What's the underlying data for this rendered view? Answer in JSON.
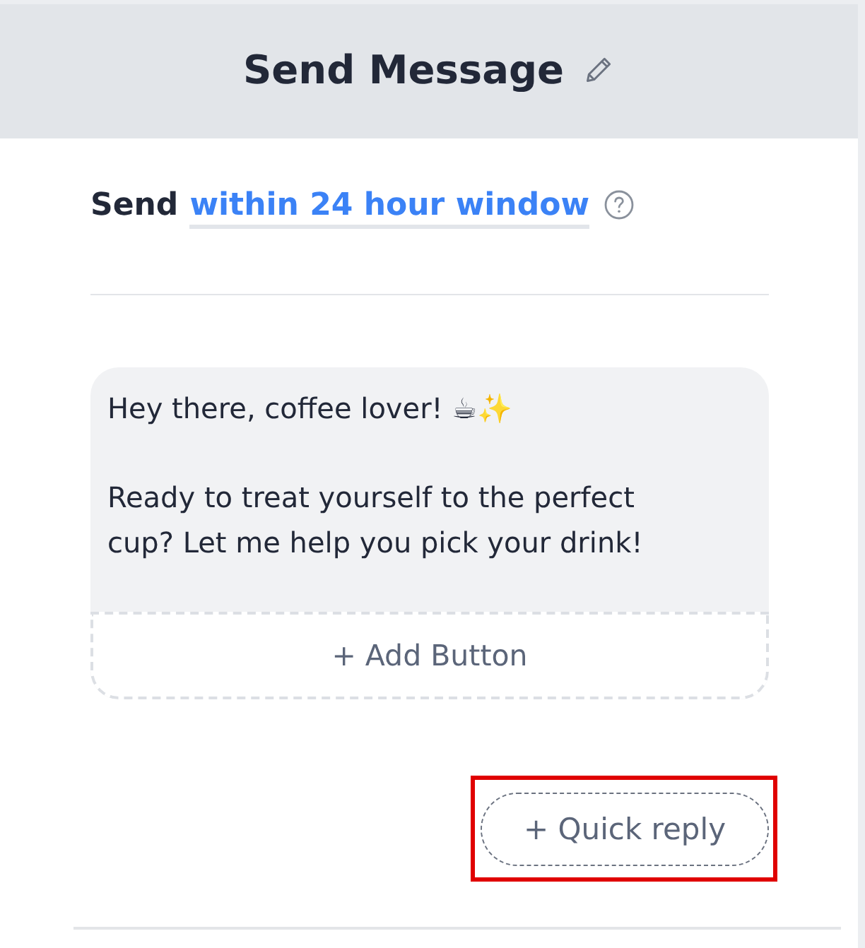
{
  "header": {
    "title": "Send Message"
  },
  "timing": {
    "label": "Send",
    "option": "within 24 hour window"
  },
  "message": {
    "text": "Hey there, coffee lover! ☕✨\n\nReady to treat yourself to the perfect cup? Let me help you pick your drink!",
    "add_button": "+ Add Button"
  },
  "quick_reply": {
    "label": "+ Quick reply",
    "highlighted": true
  }
}
